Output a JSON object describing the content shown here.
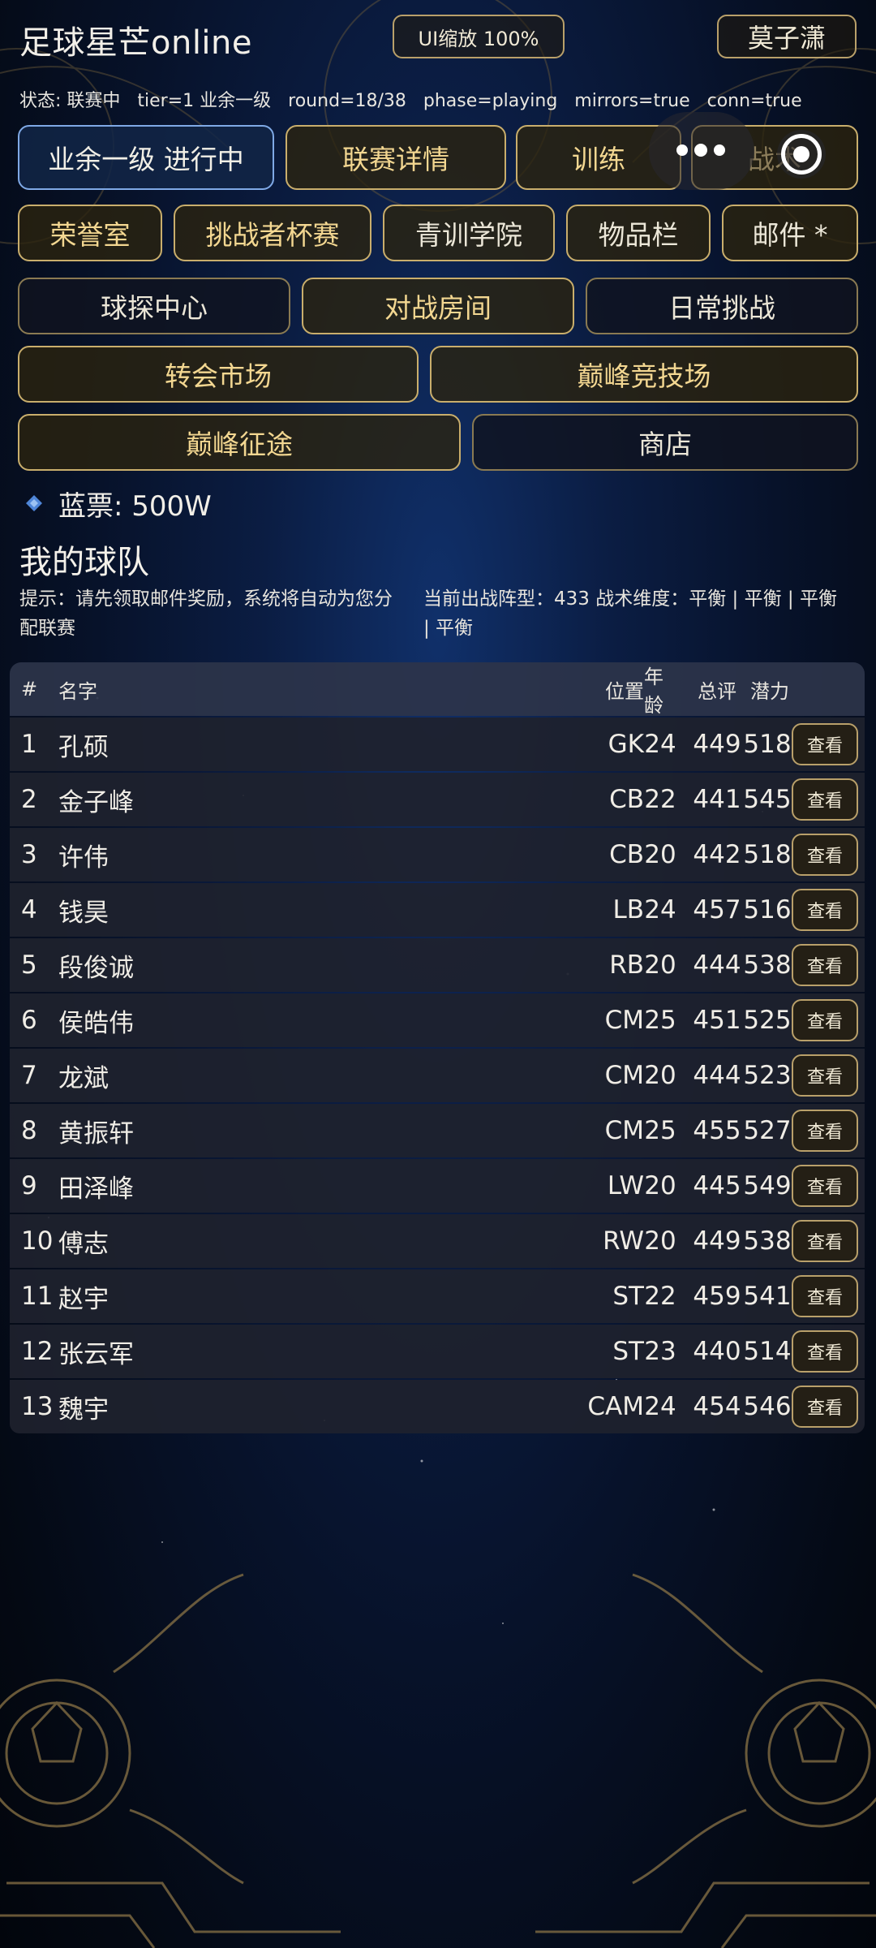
{
  "app": {
    "title": "足球星芒online",
    "zoom_label": "UI缩放 100%",
    "user_name": "莫子潇"
  },
  "status": {
    "state": "状态: 联赛中",
    "tier": "tier=1 业余一级",
    "round": "round=18/38",
    "phase": "phase=playing",
    "mirrors": "mirrors=true",
    "conn": "conn=true"
  },
  "nav": {
    "row1": [
      "业余一级 进行中",
      "联赛详情",
      "训练",
      "战术"
    ],
    "row2": [
      "荣誉室",
      "挑战者杯赛",
      "青训学院",
      "物品栏",
      "邮件 *"
    ],
    "row3": [
      "球探中心",
      "对战房间",
      "日常挑战"
    ],
    "row4": [
      "转会市场",
      "巅峰竞技场"
    ],
    "row5": [
      "巅峰征途",
      "商店"
    ]
  },
  "currency": {
    "label": "蓝票: 500W",
    "icon": "ticket-icon"
  },
  "team": {
    "title": "我的球队",
    "hint": "提示：请先领取邮件奖励，系统将自动为您分配联赛",
    "formation": "当前出战阵型：433  战术维度：平衡 | 平衡 | 平衡 | 平衡"
  },
  "table": {
    "headers": {
      "num": "#",
      "name": "名字",
      "pos": "位置",
      "age": "年龄",
      "ovr": "总评",
      "pot": "潜力"
    },
    "view_label": "查看",
    "rows": [
      {
        "num": "1",
        "name": "孔硕",
        "pos": "GK",
        "age": "24",
        "ovr": "449",
        "pot": "518"
      },
      {
        "num": "2",
        "name": "金子峰",
        "pos": "CB",
        "age": "22",
        "ovr": "441",
        "pot": "545"
      },
      {
        "num": "3",
        "name": "许伟",
        "pos": "CB",
        "age": "20",
        "ovr": "442",
        "pot": "518"
      },
      {
        "num": "4",
        "name": "钱昊",
        "pos": "LB",
        "age": "24",
        "ovr": "457",
        "pot": "516"
      },
      {
        "num": "5",
        "name": "段俊诚",
        "pos": "RB",
        "age": "20",
        "ovr": "444",
        "pot": "538"
      },
      {
        "num": "6",
        "name": "侯皓伟",
        "pos": "CM",
        "age": "25",
        "ovr": "451",
        "pot": "525"
      },
      {
        "num": "7",
        "name": "龙斌",
        "pos": "CM",
        "age": "20",
        "ovr": "444",
        "pot": "523"
      },
      {
        "num": "8",
        "name": "黄振轩",
        "pos": "CM",
        "age": "25",
        "ovr": "455",
        "pot": "527"
      },
      {
        "num": "9",
        "name": "田泽峰",
        "pos": "LW",
        "age": "20",
        "ovr": "445",
        "pot": "549"
      },
      {
        "num": "10",
        "name": "傅志",
        "pos": "RW",
        "age": "20",
        "ovr": "449",
        "pot": "538"
      },
      {
        "num": "11",
        "name": "赵宇",
        "pos": "ST",
        "age": "22",
        "ovr": "459",
        "pot": "541"
      },
      {
        "num": "12",
        "name": "张云军",
        "pos": "ST",
        "age": "23",
        "ovr": "440",
        "pot": "514"
      },
      {
        "num": "13",
        "name": "魏宇",
        "pos": "CAM",
        "age": "24",
        "ovr": "454",
        "pot": "546"
      }
    ]
  },
  "colors": {
    "gold": "#c9ae6c",
    "active_border": "#7fa9e6",
    "bg_navy": "#0b1d43"
  }
}
